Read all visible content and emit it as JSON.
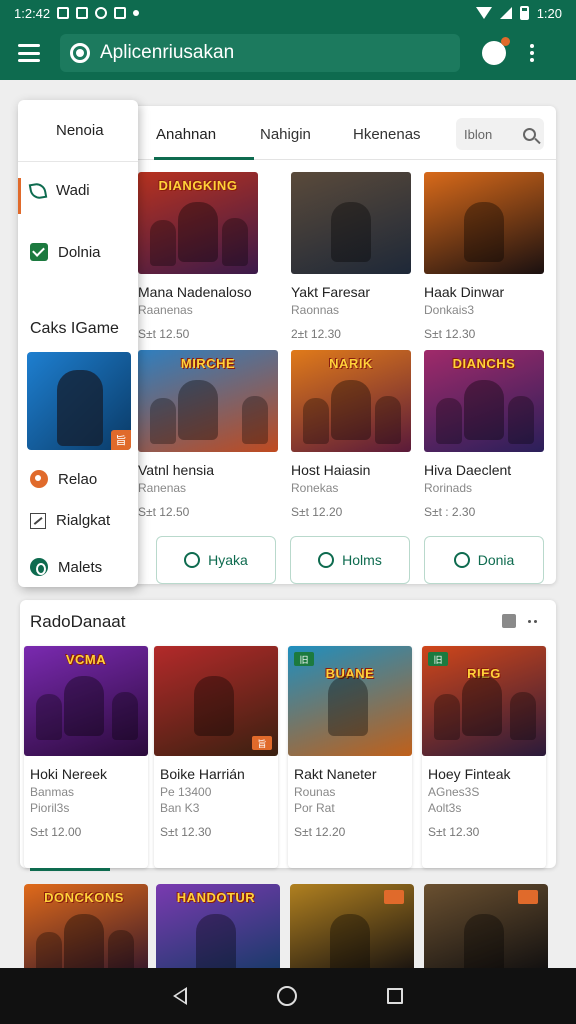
{
  "status_bar": {
    "left_time": "1:2:42",
    "right_time": "1:20"
  },
  "app_bar": {
    "title": "Aplicenriusakan"
  },
  "tabs": [
    {
      "label": "Anahnan"
    },
    {
      "label": "Nahigin"
    },
    {
      "label": "Hkenenas"
    }
  ],
  "filter": {
    "placeholder": "Iblon"
  },
  "games": [
    {
      "name": "Mana Nadenaloso",
      "sub": "Raanenas",
      "price": "S±t 12.50",
      "thumb_title": "DIANGKING",
      "c1": "#b8321f",
      "c2": "#3b1a4a"
    },
    {
      "name": "Yakt Faresar",
      "sub": "Raonnas",
      "price": "2±t 12.30",
      "thumb_title": "",
      "c1": "#5a4a3a",
      "c2": "#1e2838"
    },
    {
      "name": "Haak Dinwar",
      "sub": "Donkais3",
      "price": "S±t 12.30",
      "thumb_title": "",
      "c1": "#d86a1a",
      "c2": "#1a1010"
    },
    {
      "name": "Vatnl hensia",
      "sub": "Ranenas",
      "price": "S±t 12.50",
      "thumb_title": "MIRCHE",
      "c1": "#2f7fbf",
      "c2": "#c04a1f"
    },
    {
      "name": "Host Haiasin",
      "sub": "Ronekas",
      "price": "S±t 12.20",
      "thumb_title": "NARIK",
      "c1": "#e07a1a",
      "c2": "#5a1a3a"
    },
    {
      "name": "Hiva Daeclent",
      "sub": "Rorinads",
      "price": "S±t : 2.30",
      "thumb_title": "DIANCHS",
      "c1": "#a02a6a",
      "c2": "#2a1f5a"
    }
  ],
  "outline_buttons": [
    {
      "label": "Hyaka"
    },
    {
      "label": "Holms"
    },
    {
      "label": "Donia"
    }
  ],
  "dropdown": {
    "header": "Nenoia",
    "items": [
      {
        "label": "Wadi"
      },
      {
        "label": "Dolnia"
      }
    ],
    "section_title": "Caks IGame",
    "badge": "旨",
    "actions": [
      {
        "label": "Relao"
      },
      {
        "label": "Rialgkat"
      },
      {
        "label": "Malets"
      }
    ]
  },
  "recommended": {
    "title": "RadoDanaat",
    "games": [
      {
        "name": "Hoki Nereek",
        "sub": "Banmas",
        "sub2": "Pioril3s",
        "price": "S±t 12.00",
        "thumb_title": "VCMA",
        "c1": "#7a2ab0",
        "c2": "#2a0a3a",
        "badge": ""
      },
      {
        "name": "Boike Harrián",
        "sub": "Pe 13400",
        "sub2": "Ban K3",
        "price": "S±t 12.30",
        "thumb_title": "",
        "c1": "#b32a2a",
        "c2": "#3a2010",
        "badge": "旨"
      },
      {
        "name": "Rakt Naneter",
        "sub": "Rounas",
        "sub2": "Por Rat",
        "price": "S±t 12.20",
        "thumb_title": "BUANE",
        "c1": "#1f8fbf",
        "c2": "#c0601a",
        "badge": "旧"
      },
      {
        "name": "Hoey Finteak",
        "sub": "AGnes3S",
        "sub2": "Aolt3s",
        "price": "S±t 12.30",
        "thumb_title": "RIEG",
        "c1": "#d0461a",
        "c2": "#2a1a3a",
        "badge": "旧"
      }
    ]
  },
  "bottom_tiles": [
    {
      "title": "DONCKONS",
      "c1": "#e06a1a",
      "c2": "#3a1a2a"
    },
    {
      "title": "HANDOTUR",
      "c1": "#7a3ab0",
      "c2": "#1a3a6a"
    },
    {
      "title": "",
      "c1": "#b08020",
      "c2": "#1a1410"
    },
    {
      "title": "",
      "c1": "#6a5030",
      "c2": "#121010"
    }
  ]
}
